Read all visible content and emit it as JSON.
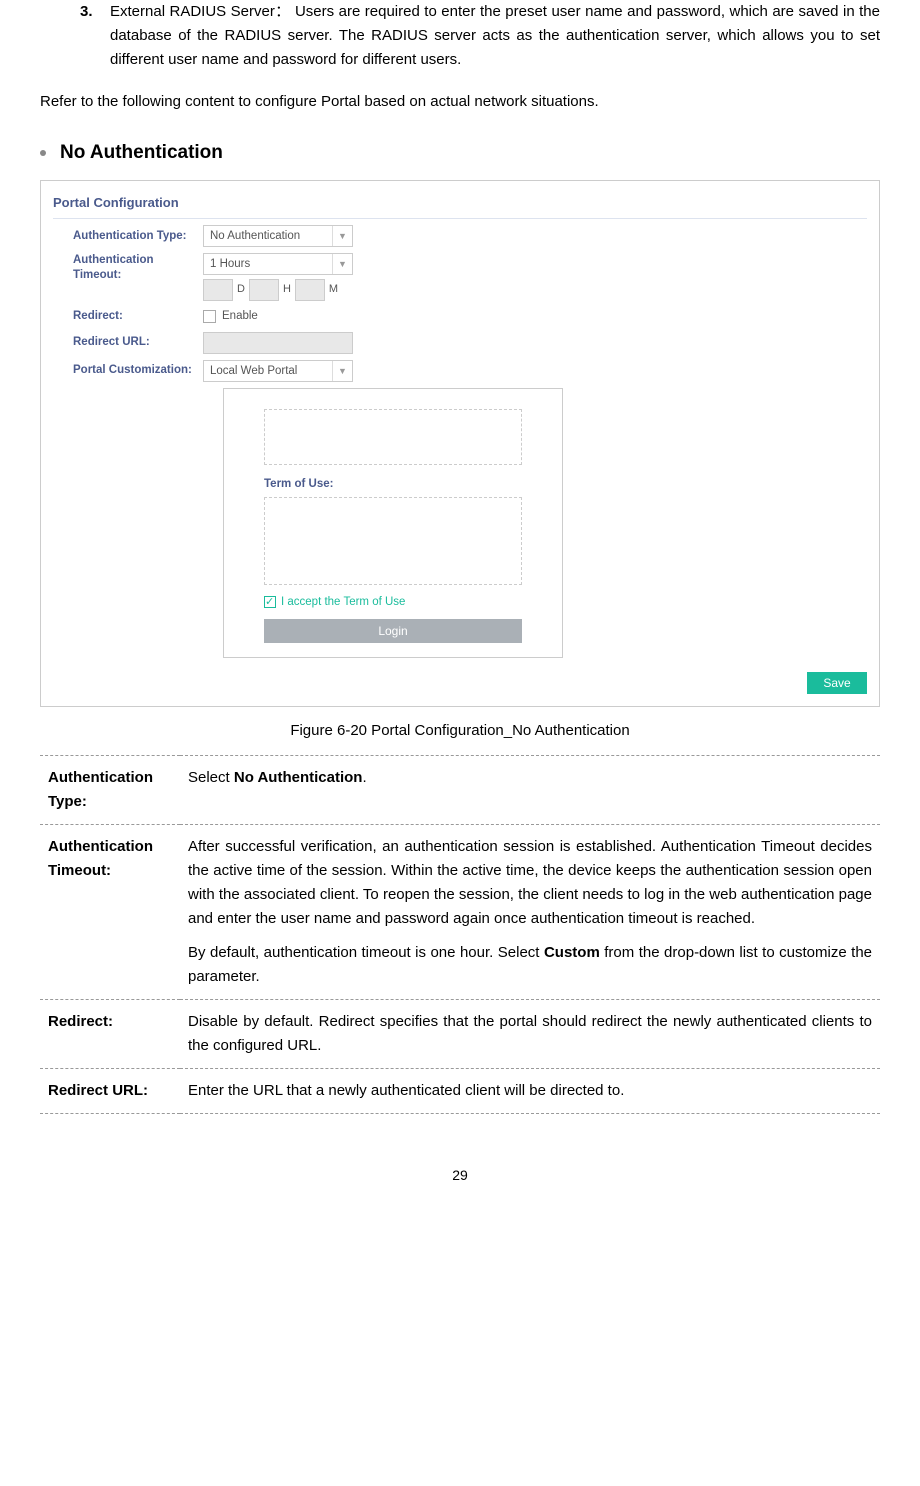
{
  "intro": {
    "item_num": "3.",
    "item_text": "External RADIUS Server： Users are required to enter the preset user name and password, which are saved in the database of the RADIUS server. The RADIUS server acts as the authentication server, which allows you to set different user name and password for different users.",
    "refer": "Refer to the following content to configure Portal based on actual network situations."
  },
  "section": {
    "title": "No Authentication"
  },
  "figure": {
    "panel_title": "Portal Configuration",
    "labels": {
      "auth_type": "Authentication Type:",
      "auth_timeout": "Authentication Timeout:",
      "redirect": "Redirect:",
      "redirect_url": "Redirect URL:",
      "portal_custom": "Portal Customization:"
    },
    "values": {
      "auth_type": "No Authentication",
      "auth_timeout": "1 Hours",
      "d": "D",
      "h": "H",
      "m": "M",
      "enable": "Enable",
      "portal_custom": "Local Web Portal"
    },
    "preview": {
      "term_label": "Term of Use:",
      "accept": "I accept the Term of Use",
      "login": "Login"
    },
    "save": "Save",
    "caption": "Figure 6-20 Portal Configuration_No Authentication"
  },
  "table": {
    "rows": [
      {
        "label": "Authentication Type:",
        "paras": [
          {
            "pre": "Select ",
            "bold": "No Authentication",
            "post": "."
          }
        ]
      },
      {
        "label": "Authentication Timeout:",
        "paras": [
          {
            "pre": "After successful verification, an authentication session is established. Authentication Timeout decides the active time of the session. Within the active time, the device keeps the authentication session open with the associated client. To reopen the session, the client needs to log in the web authentication page and enter the user name and password again once authentication timeout is reached.",
            "bold": "",
            "post": ""
          },
          {
            "pre": "By default, authentication timeout is one hour. Select ",
            "bold": "Custom",
            "post": " from the drop-down list to customize the parameter."
          }
        ]
      },
      {
        "label": "Redirect:",
        "paras": [
          {
            "pre": "Disable by default. Redirect specifies that the portal should redirect the newly authenticated clients to the configured URL.",
            "bold": "",
            "post": ""
          }
        ]
      },
      {
        "label": "Redirect URL:",
        "paras": [
          {
            "pre": "Enter the URL that a newly authenticated client will be directed to.",
            "bold": "",
            "post": ""
          }
        ]
      }
    ]
  },
  "page_number": "29"
}
